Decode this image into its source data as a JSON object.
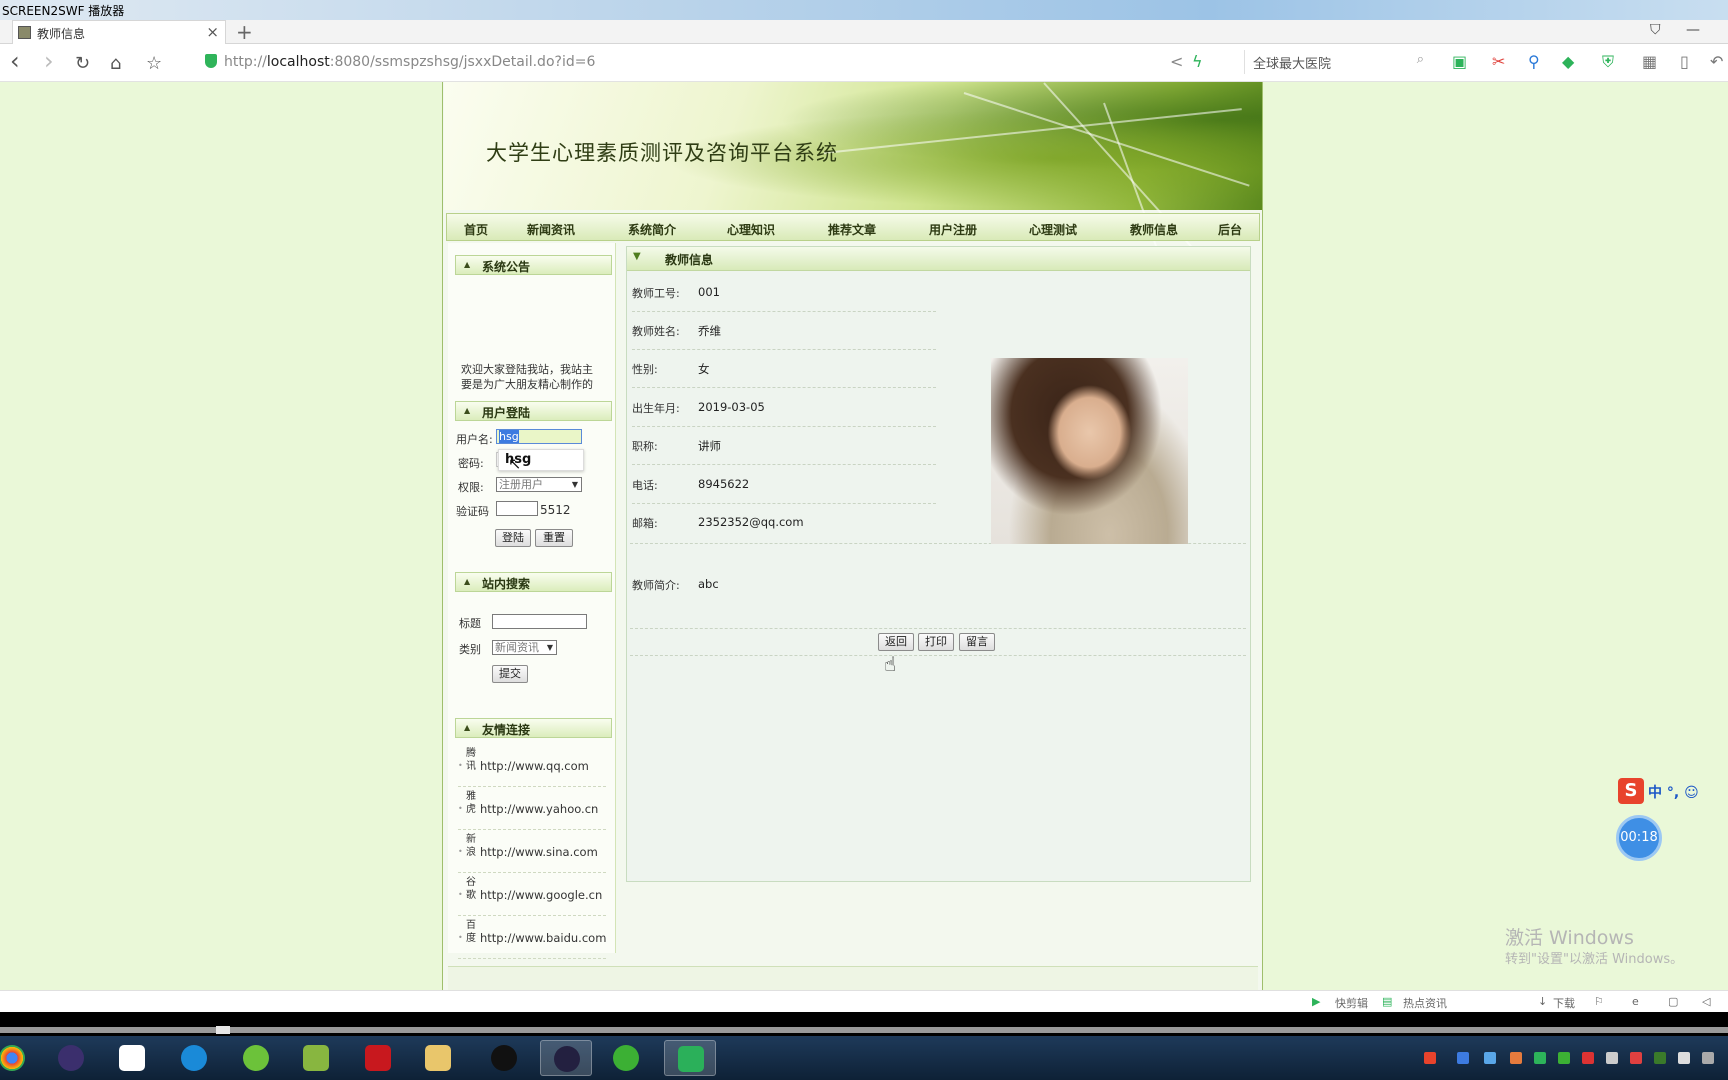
{
  "player": {
    "title": "SCREEN2SWF 播放器"
  },
  "browser": {
    "tab_title": "教师信息",
    "tab_close": "×",
    "new_tab": "+",
    "url_prefix": "http://",
    "url_host": "localhost",
    "url_rest": ":8080/ssmspzshsg/jsxxDetail.do?id=6",
    "search_text": "全球最大医院",
    "nav_back": "‹",
    "nav_forward": "›",
    "nav_reload": "↻",
    "nav_home": "⌂",
    "nav_star": "☆",
    "search_icon": "⌕",
    "window_min": "—",
    "window_shirt": "⛉"
  },
  "site": {
    "title": "大学生心理素质测评及咨询平台系统",
    "nav": [
      "首页",
      "新闻资讯",
      "系统简介",
      "心理知识",
      "推荐文章",
      "用户注册",
      "心理测试",
      "教师信息",
      "后台"
    ]
  },
  "sidebar": {
    "announcement": {
      "title": "系统公告",
      "text_line1": "欢迎大家登陆我站，我站主",
      "text_line2": "要是为广大朋友精心制作的"
    },
    "login": {
      "title": "用户登陆",
      "username_label": "用户名:",
      "username_value": "hsg",
      "password_label": "密码:",
      "autocomplete_suggestion": "hsg",
      "role_label": "权限:",
      "role_value": "注册用户",
      "captcha_label": "验证码",
      "captcha_code": "5512",
      "login_button": "登陆",
      "reset_button": "重置"
    },
    "search": {
      "title": "站内搜索",
      "title_label": "标题",
      "category_label": "类别",
      "category_value": "新闻资讯",
      "submit_button": "提交"
    },
    "links": {
      "title": "友情连接",
      "items": [
        {
          "name": "腾讯",
          "url": "http://www.qq.com"
        },
        {
          "name": "雅虎",
          "url": "http://www.yahoo.cn"
        },
        {
          "name": "新浪",
          "url": "http://www.sina.com"
        },
        {
          "name": "谷歌",
          "url": "http://www.google.cn"
        },
        {
          "name": "百度",
          "url": "http://www.baidu.com"
        }
      ]
    }
  },
  "teacher": {
    "panel_title": "教师信息",
    "fields": [
      {
        "label": "教师工号:",
        "value": "001"
      },
      {
        "label": "教师姓名:",
        "value": "乔维"
      },
      {
        "label": "性别:",
        "value": "女"
      },
      {
        "label": "出生年月:",
        "value": "2019-03-05"
      },
      {
        "label": "职称:",
        "value": "讲师"
      },
      {
        "label": "电话:",
        "value": "8945622"
      },
      {
        "label": "邮箱:",
        "value": "2352352@qq.com"
      }
    ],
    "intro_label": "教师简介:",
    "intro_value": "abc",
    "buttons": {
      "back": "返回",
      "print": "打印",
      "message": "留言"
    }
  },
  "overlay": {
    "ime_logo": "S",
    "ime_text": "中 °, ☺",
    "timer": "00:18",
    "activate_title": "激活 Windows",
    "activate_sub": "转到\"设置\"以激活 Windows。"
  },
  "statusbar": {
    "quick_clip": "快剪辑",
    "hot_news": "热点资讯",
    "download": "下载"
  },
  "colors": {
    "page_bg": "#eaf8d8",
    "accent_green": "#9fbf6c",
    "taskbar": "#0e2136"
  }
}
